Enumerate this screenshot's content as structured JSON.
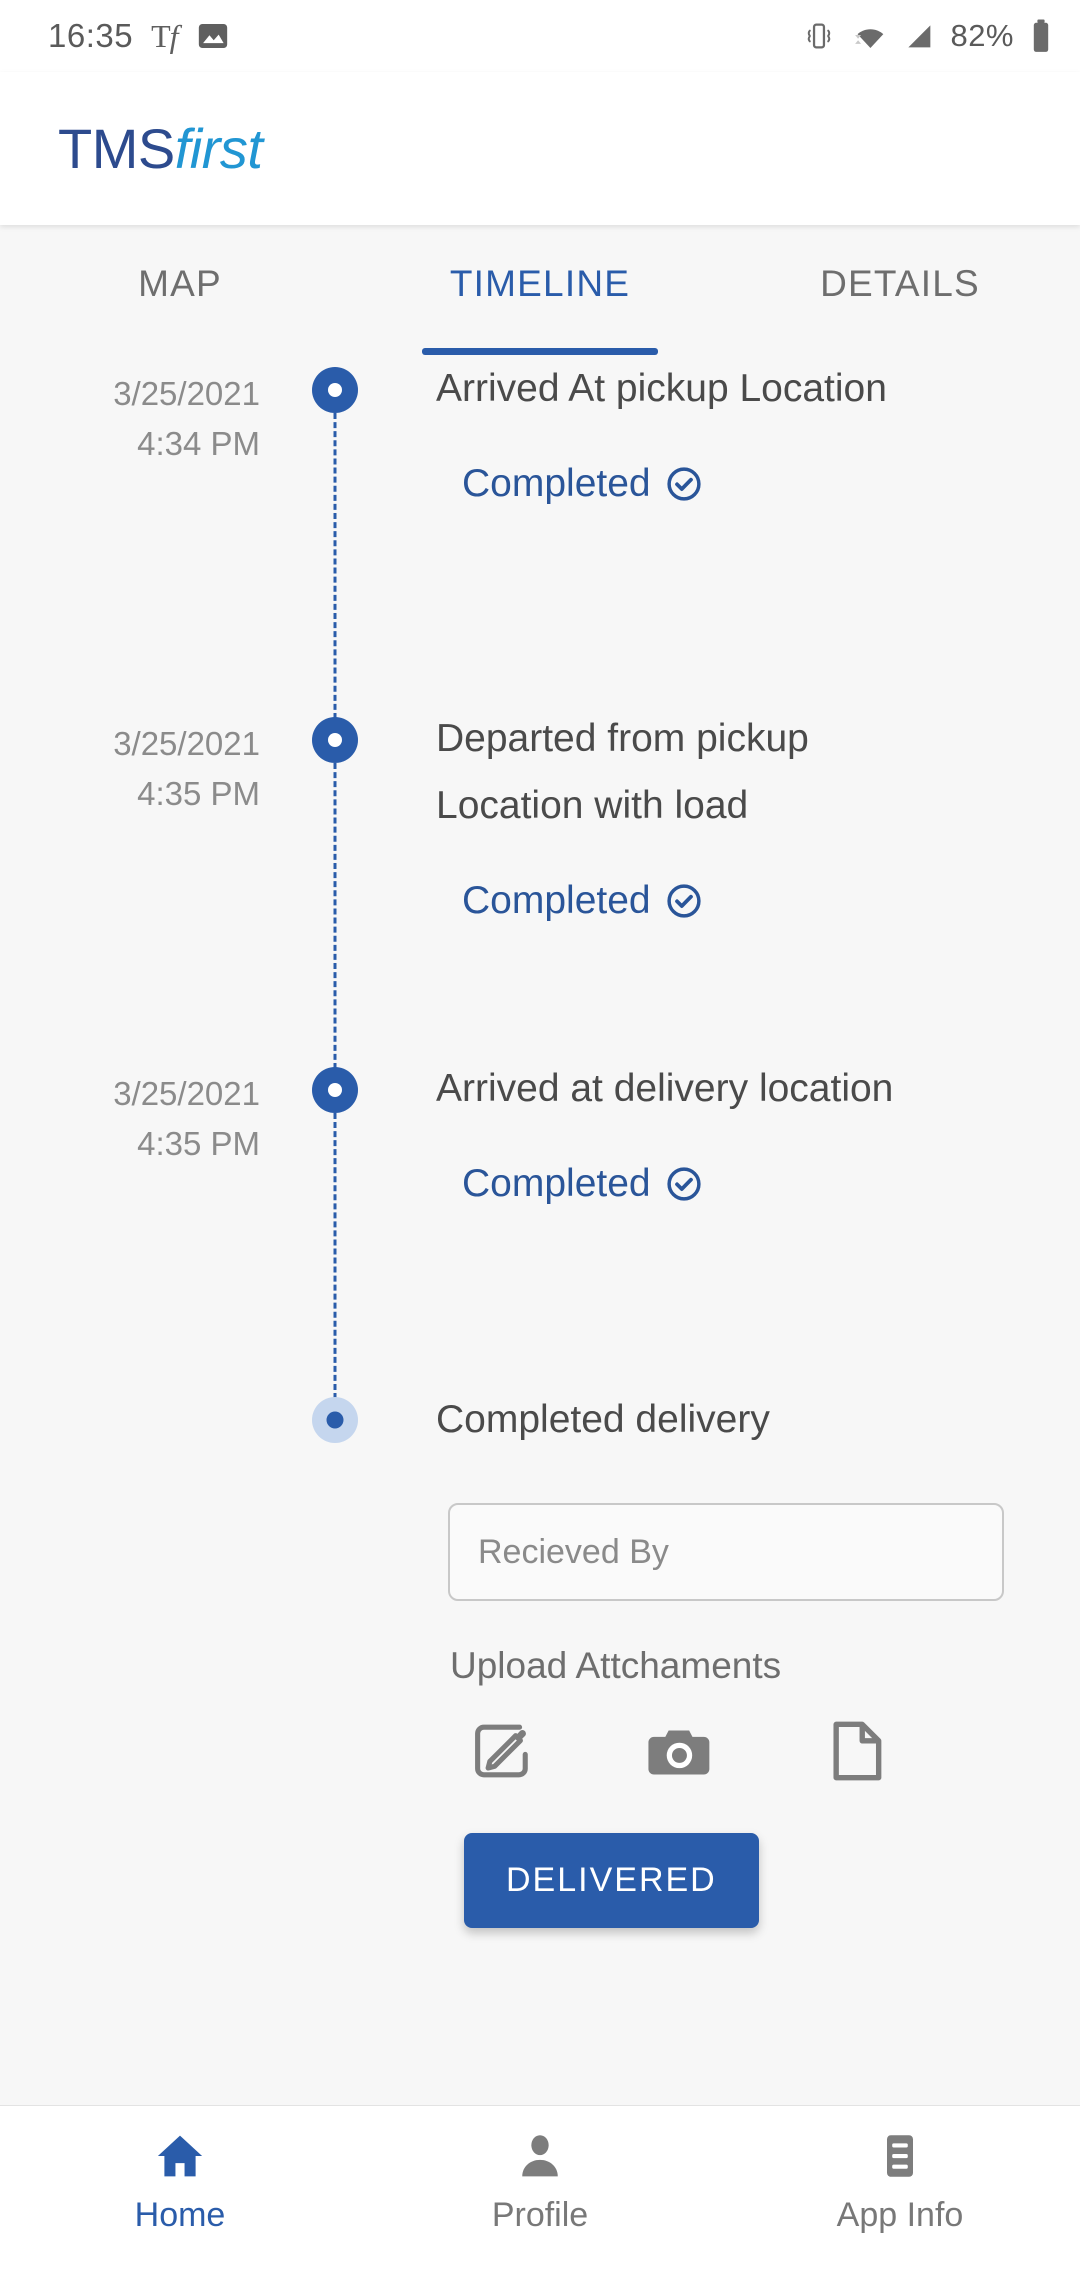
{
  "status_bar": {
    "clock": "16:35",
    "font_icon_label": "Tf",
    "image_icon_name": "image-icon",
    "vibrate_icon_name": "vibrate-icon",
    "wifi_icon_name": "wifi-icon",
    "signal_icon_name": "signal-icon",
    "battery_percent": "82%",
    "battery_icon_name": "battery-icon"
  },
  "header": {
    "logo_primary": "TMS",
    "logo_secondary": "first"
  },
  "tabs": [
    {
      "label": "MAP",
      "active": false
    },
    {
      "label": "TIMELINE",
      "active": true
    },
    {
      "label": "DETAILS",
      "active": false
    }
  ],
  "timeline": {
    "events": [
      {
        "date": "3/25/2021",
        "time": "4:34 PM",
        "title": "Arrived At pickup Location",
        "status": "Completed",
        "state": "done"
      },
      {
        "date": "3/25/2021",
        "time": "4:35 PM",
        "title": "Departed from pickup Location with load",
        "status": "Completed",
        "state": "done"
      },
      {
        "date": "3/25/2021",
        "time": "4:35 PM",
        "title": "Arrived at delivery location",
        "status": "Completed",
        "state": "done"
      },
      {
        "date": "",
        "time": "",
        "title": "Completed delivery",
        "status": "",
        "state": "pending"
      }
    ]
  },
  "delivery_form": {
    "received_by_value": "",
    "received_by_placeholder": "Recieved By",
    "upload_label": "Upload Attchaments",
    "upload_options": [
      {
        "name": "signature-icon"
      },
      {
        "name": "camera-icon"
      },
      {
        "name": "document-icon"
      }
    ],
    "delivered_button": "DELIVERED"
  },
  "bottom_nav": [
    {
      "label": "Home",
      "icon": "home-icon",
      "active": true
    },
    {
      "label": "Profile",
      "icon": "person-icon",
      "active": false
    },
    {
      "label": "App Info",
      "icon": "app-info-icon",
      "active": false
    }
  ],
  "colors": {
    "brand_dark_blue": "#2d4b8e",
    "brand_light_blue": "#2196d3",
    "accent_blue": "#2a5caa",
    "status_blue": "#2a5599",
    "pending_dot": "#c5d6ee",
    "page_bg": "#f7f7f7",
    "text_gray": "#4a4a4a",
    "muted_gray": "#8b8b8b"
  }
}
